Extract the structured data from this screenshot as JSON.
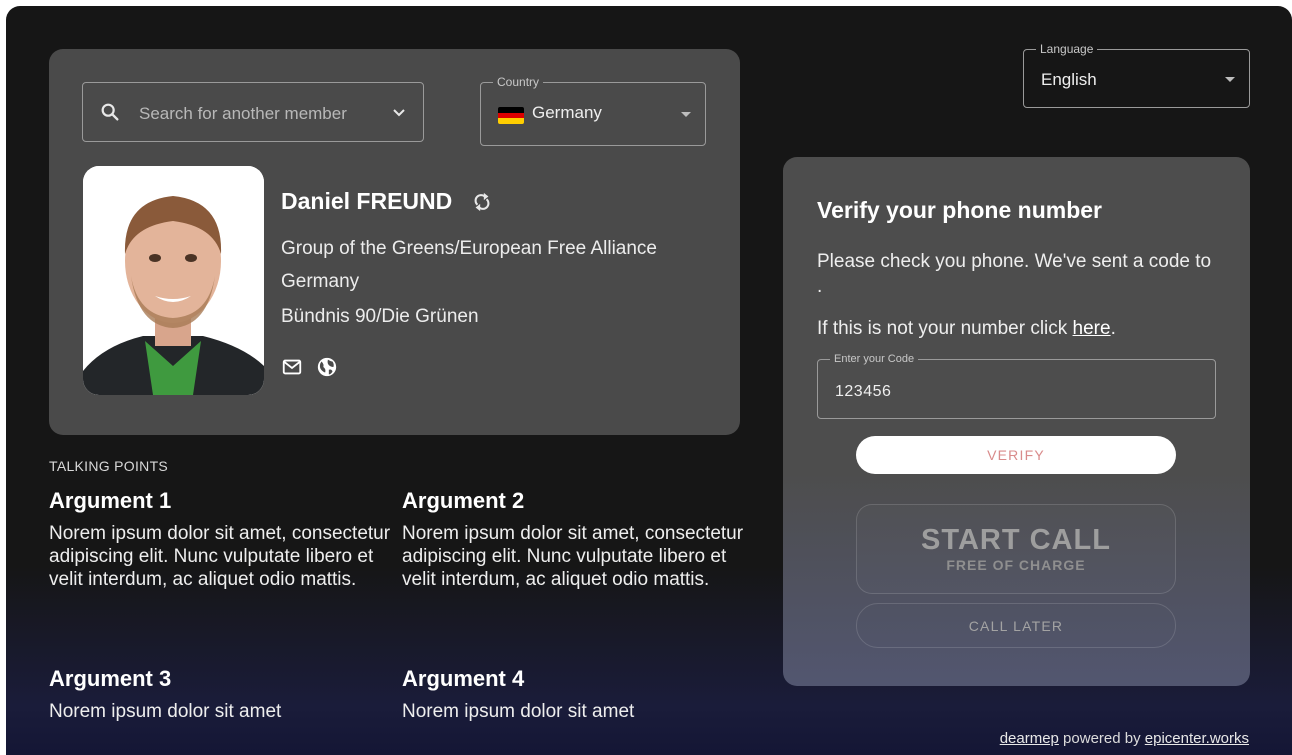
{
  "search": {
    "placeholder": "Search for another member"
  },
  "country": {
    "label": "Country",
    "value": "Germany",
    "flag_colors": [
      "#000000",
      "#dd0000",
      "#ffce00"
    ]
  },
  "language": {
    "label": "Language",
    "value": "English"
  },
  "mep": {
    "name": "Daniel FREUND",
    "group": "Group of the Greens/European Free Alliance",
    "country": "Germany",
    "party": "Bündnis 90/Die Grünen",
    "icons": [
      "refresh-icon",
      "mail-icon",
      "globe-icon"
    ]
  },
  "talking_points": {
    "heading": "Talking Points",
    "arguments": [
      {
        "title": "Argument 1",
        "body": "Norem ipsum dolor sit amet, consectetur adipiscing elit. Nunc vulputate libero et velit interdum, ac aliquet odio mattis."
      },
      {
        "title": "Argument 2",
        "body": "Norem ipsum dolor sit amet, consectetur adipiscing elit. Nunc vulputate libero et velit interdum, ac aliquet odio mattis."
      },
      {
        "title": "Argument 3",
        "body": "Norem ipsum dolor sit amet"
      },
      {
        "title": "Argument 4",
        "body": "Norem ipsum dolor sit amet"
      }
    ]
  },
  "verify": {
    "title": "Verify your phone number",
    "text1": "Please check you phone. We've sent a code to .",
    "text2_prefix": "If this is not your number click ",
    "text2_link": "here",
    "text2_suffix": ".",
    "code_label": "Enter your Code",
    "code_value": "123456",
    "verify_label": "Verify",
    "start_call_label": "START CALL",
    "start_call_sub": "FREE OF CHARGE",
    "call_later_label": "CALL LATER"
  },
  "footer": {
    "brand": "dearmep",
    "text": " powered by ",
    "org": "epicenter.works"
  },
  "colors": {
    "background": "#161616",
    "card": "#4a4a4a",
    "verify_text": "#d98b8b"
  }
}
